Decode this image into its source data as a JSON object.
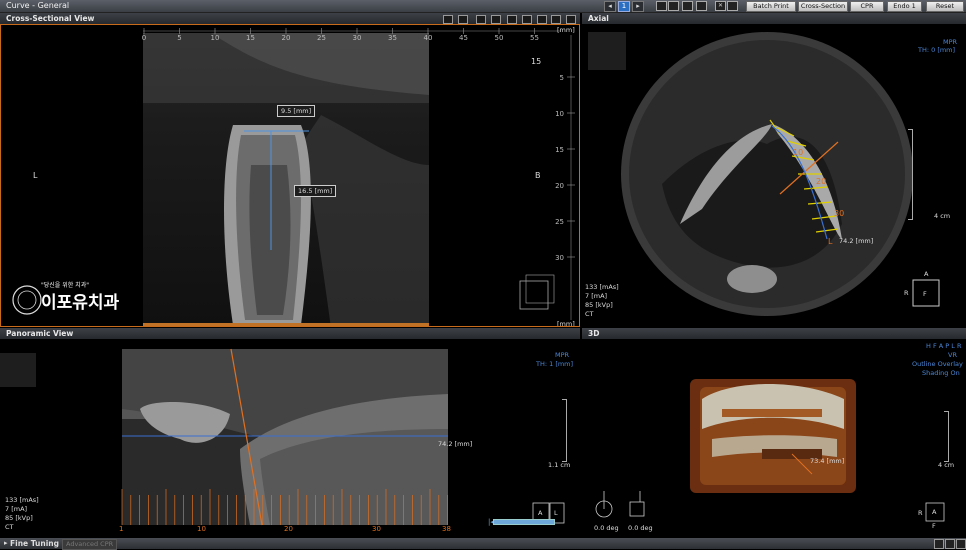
{
  "app": {
    "title": "Curve - General"
  },
  "topbar": {
    "page_current": "1",
    "buttons": [
      "Batch Print",
      "Cross-Section",
      "CPR",
      "Endo 1",
      "Reset"
    ]
  },
  "cross_section": {
    "title": "Cross-Sectional View",
    "ruler_h": [
      "0",
      "5",
      "10",
      "15",
      "20",
      "25",
      "30",
      "35",
      "40",
      "45",
      "50",
      "55"
    ],
    "ruler_unit": "[mm]",
    "ruler_v": [
      "5",
      "10",
      "15",
      "20",
      "25",
      "30"
    ],
    "scale_top": "15",
    "label_left": "L",
    "label_right": "B",
    "measure_width": "9.5 [mm]",
    "measure_height": "16.5 [mm]",
    "clinic_slogan": "\"당신을 위한 치과\"",
    "clinic_name": "이포유치과"
  },
  "axial": {
    "title": "Axial",
    "mode": "MPR",
    "thickness": "TH: 0 [mm]",
    "scale": "4 cm",
    "ct_params": [
      "133 [mAs]",
      "7 [mA]",
      "85 [kVp]",
      "CT"
    ],
    "orient_top": "A",
    "orient_left": "R",
    "orient_center": "F",
    "curve_length": "74.2 [mm]",
    "curve_end": "L",
    "tick_labels": [
      "10",
      "20",
      "30"
    ]
  },
  "panoramic": {
    "title": "Panoramic View",
    "mode": "MPR",
    "thickness": "TH: 1 [mm]",
    "scale": "1.1 cm",
    "length": "74.2 [mm]",
    "ct_params": [
      "133 [mAs]",
      "7 [mA]",
      "85 [kVp]",
      "CT"
    ],
    "axis_ticks": [
      "1",
      "10",
      "20",
      "30",
      "38"
    ],
    "orient_a": "A",
    "orient_l": "L"
  },
  "view3d": {
    "title": "3D",
    "options": [
      "H F A P L R",
      "VR",
      "Outline Overlay",
      "Shading On"
    ],
    "scale": "4 cm",
    "orient_left": "R",
    "orient_center": "A",
    "orient_bottom": "F",
    "rot1": "0.0 deg",
    "rot2": "0.0 deg",
    "measure": "73.4 [mm]"
  },
  "bottom": {
    "fine_tuning": "Fine Tuning",
    "advanced": "Advanced CPR"
  }
}
